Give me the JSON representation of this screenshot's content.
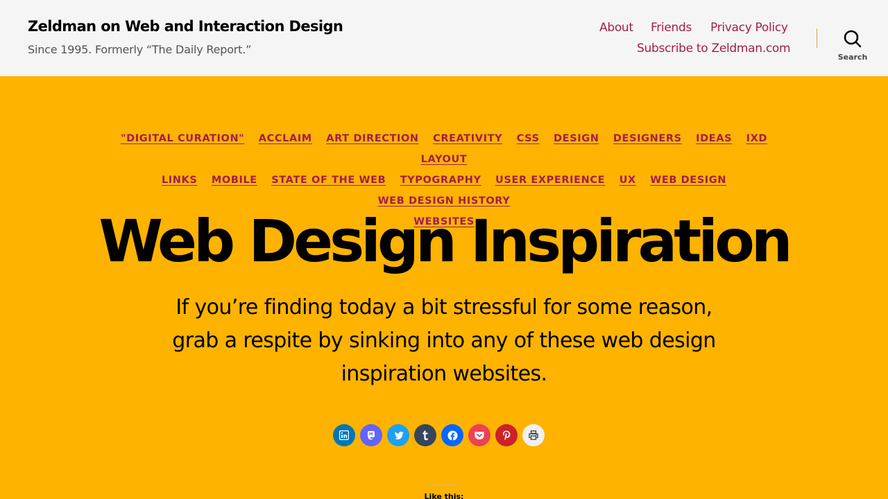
{
  "header": {
    "site_title": "Zeldman on Web and Interaction Design",
    "site_description": "Since 1995. Formerly “The Daily Report.”",
    "menu": [
      "About",
      "Friends",
      "Privacy Policy",
      "Subscribe to Zeldman.com"
    ],
    "search_label": "Search"
  },
  "categories": [
    "\"DIGITAL CURATION\"",
    "ACCLAIM",
    "ART DIRECTION",
    "CREATIVITY",
    "CSS",
    "DESIGN",
    "DESIGNERS",
    "IDEAS",
    "IXD",
    "LAYOUT",
    "LINKS",
    "MOBILE",
    "STATE OF THE WEB",
    "TYPOGRAPHY",
    "USER EXPERIENCE",
    "UX",
    "WEB DESIGN",
    "WEB DESIGN HISTORY",
    "WEBSITES"
  ],
  "post": {
    "title": "Web Design Inspiration",
    "excerpt": "If you’re finding today a bit stressful for some reason, grab a respite by sinking into any of these web design inspiration websites."
  },
  "share": [
    {
      "icon": "linkedin-icon",
      "color": "#0077b5"
    },
    {
      "icon": "mastodon-icon",
      "color": "#6364ff"
    },
    {
      "icon": "twitter-icon",
      "color": "#1da1f2"
    },
    {
      "icon": "tumblr-icon",
      "color": "#35465c"
    },
    {
      "icon": "facebook-icon",
      "color": "#0866ff"
    },
    {
      "icon": "pocket-icon",
      "color": "#ef4056"
    },
    {
      "icon": "pinterest-icon",
      "color": "#cc2127"
    },
    {
      "icon": "print-icon",
      "color": "#f0f0f0"
    }
  ],
  "like": {
    "label": "Like this:"
  },
  "colors": {
    "accent": "#a41d4b",
    "background": "#fdb300",
    "header_bg": "#f5f5f5"
  }
}
